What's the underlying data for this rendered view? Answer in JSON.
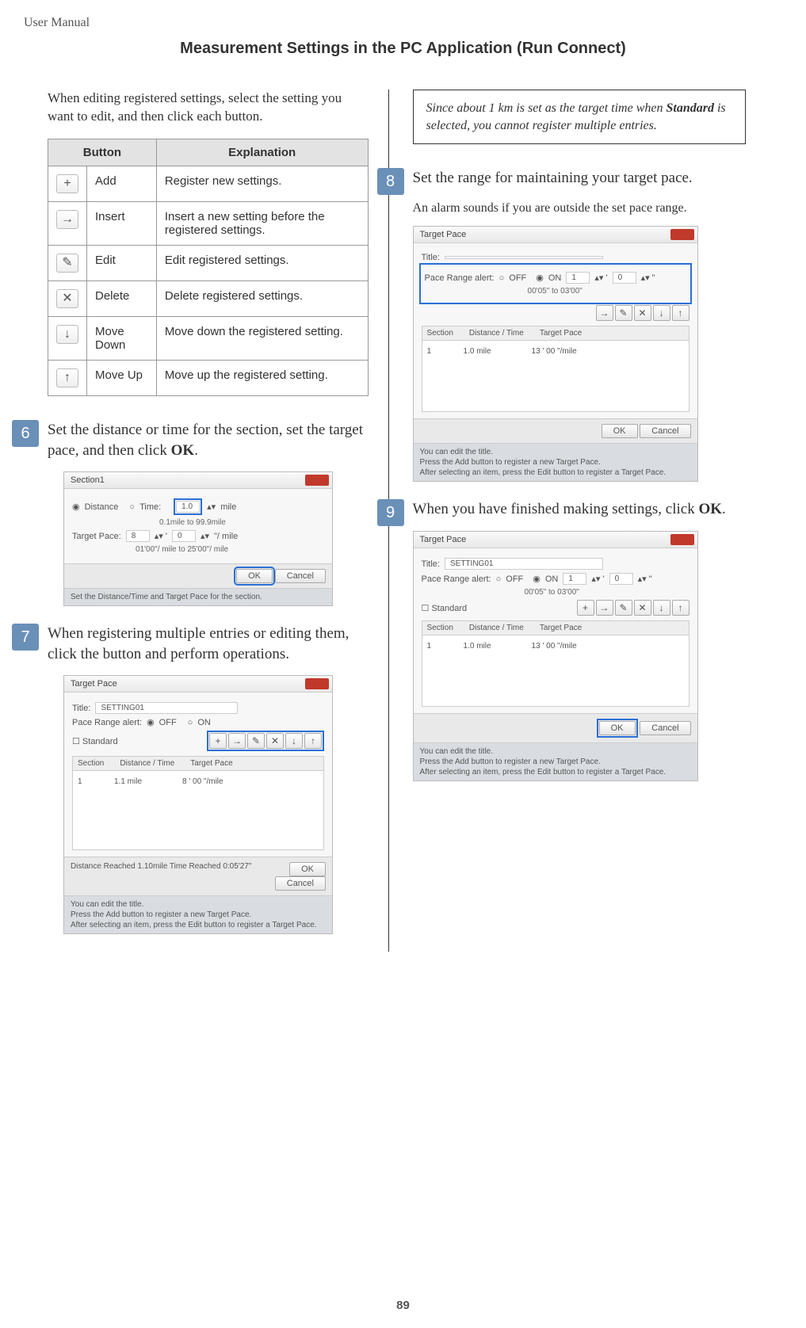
{
  "header": {
    "left": "User Manual"
  },
  "title": "Measurement Settings in the PC Application (Run Connect)",
  "intro_left": "When editing registered settings, select the setting you want to edit, and then click each button.",
  "button_table": {
    "headers": {
      "button": "Button",
      "explanation": "Explanation"
    },
    "rows": [
      {
        "glyph": "+",
        "name": "Add",
        "desc": "Register new settings."
      },
      {
        "glyph": "→",
        "name": "Insert",
        "desc": "Insert a new setting before the registered settings."
      },
      {
        "glyph": "✎",
        "name": "Edit",
        "desc": "Edit registered settings."
      },
      {
        "glyph": "✕",
        "name": "Delete",
        "desc": "Delete registered settings."
      },
      {
        "glyph": "↓",
        "name": "Move Down",
        "desc": "Move down the registered setting."
      },
      {
        "glyph": "↑",
        "name": "Move Up",
        "desc": "Move up the registered setting."
      }
    ]
  },
  "steps": {
    "s6": {
      "num": "6",
      "text_pre": "Set the distance or time for the section, set the target pace, and then click ",
      "bold": "OK",
      "text_post": "."
    },
    "s7": {
      "num": "7",
      "text": "When registering multiple entries or editing them, click the button and perform operations."
    },
    "s8": {
      "num": "8",
      "text": "Set the range for maintaining your target pace.",
      "sub": "An alarm sounds if you are outside the set pace range."
    },
    "s9": {
      "num": "9",
      "text_pre": "When you have finished making settings, click ",
      "bold": "OK",
      "text_post": "."
    }
  },
  "note": {
    "pre": "Since about 1 km is set as the target time when ",
    "bold": "Standard",
    "post": " is selected, you cannot register multiple entries."
  },
  "screenshots": {
    "section1": {
      "title": "Section1",
      "distance_label": "Distance",
      "time_label": "Time:",
      "dist_value": "1.0",
      "dist_unit": "mile",
      "dist_range": "0.1mile to 99.9mile",
      "pace_label": "Target Pace:",
      "pace_min": "8",
      "pace_sec": "0",
      "pace_unit": "\"/ mile",
      "pace_range": "01'00\"/ mile to 25'00\"/ mile",
      "ok": "OK",
      "cancel": "Cancel",
      "help": "Set the Distance/Time and Target Pace for the section."
    },
    "tp_common": {
      "title": "Target Pace",
      "title_label": "Title:",
      "title_value": "SETTING01",
      "alert_label": "Pace Range alert:",
      "off": "OFF",
      "on": "ON",
      "standard": "Standard",
      "cols": {
        "section": "Section",
        "dt": "Distance / Time",
        "tp": "Target Pace"
      },
      "row": {
        "section": "1",
        "dt": "1.0 mile",
        "tp": "13 ' 00 \"/mile"
      },
      "ok": "OK",
      "cancel": "Cancel",
      "help1": "You can edit the title.",
      "help2": "Press the Add button to register a new Target Pace.",
      "help3": "After selecting an item, press the Edit button to register a Target Pace."
    },
    "s7_extra": {
      "row_dt": "1.1 mile",
      "row_tp": "8 ' 00 \"/mile",
      "summary": "Distance Reached  1.10mile     Time Reached  0:05'27\""
    },
    "s8_extra": {
      "rmin": "1",
      "rsec": "0",
      "range_text": "00'05\" to 03'00\""
    }
  },
  "page_number": "89"
}
